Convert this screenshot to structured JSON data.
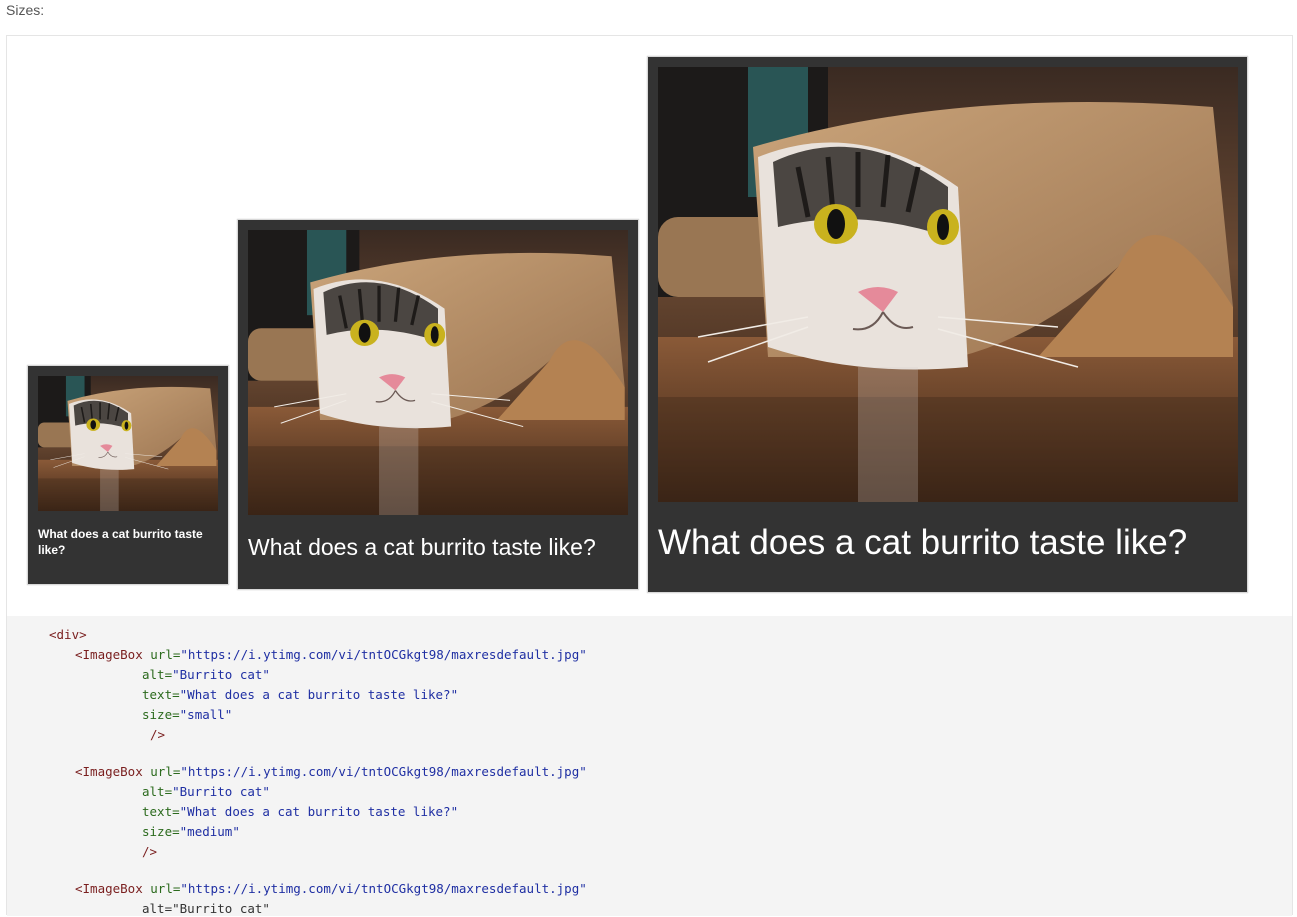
{
  "section": {
    "label": "Sizes:"
  },
  "imageboxes": [
    {
      "size": "small",
      "alt": "Burrito cat",
      "caption": "What does a cat burrito taste like?"
    },
    {
      "size": "medium",
      "alt": "Burrito cat",
      "caption": "What does a cat burrito taste like?"
    },
    {
      "size": "large",
      "alt": "Burrito cat",
      "caption": "What does a cat burrito taste like?"
    }
  ],
  "code": {
    "open_div": "<div>",
    "tag_open": "<ImageBox",
    "attr_url": "url=",
    "url_value": "\"https://i.ytimg.com/vi/tntOCGkgt98/maxresdefault.jpg\"",
    "attr_alt": "alt=",
    "alt_value": "\"Burrito cat\"",
    "attr_text": "text=",
    "text_value": "\"What does a cat burrito taste like?\"",
    "attr_size": "size=",
    "size_small": "\"small\"",
    "size_medium": "\"medium\"",
    "self_close": "/>",
    "partial_alt": "alt=\"Burrito cat\""
  },
  "colors": {
    "box_background": "#333333",
    "code_background": "#f4f4f4",
    "code_tag": "#7a1f1f",
    "code_attr": "#2b6a1d",
    "code_string": "#1f2fa3"
  }
}
